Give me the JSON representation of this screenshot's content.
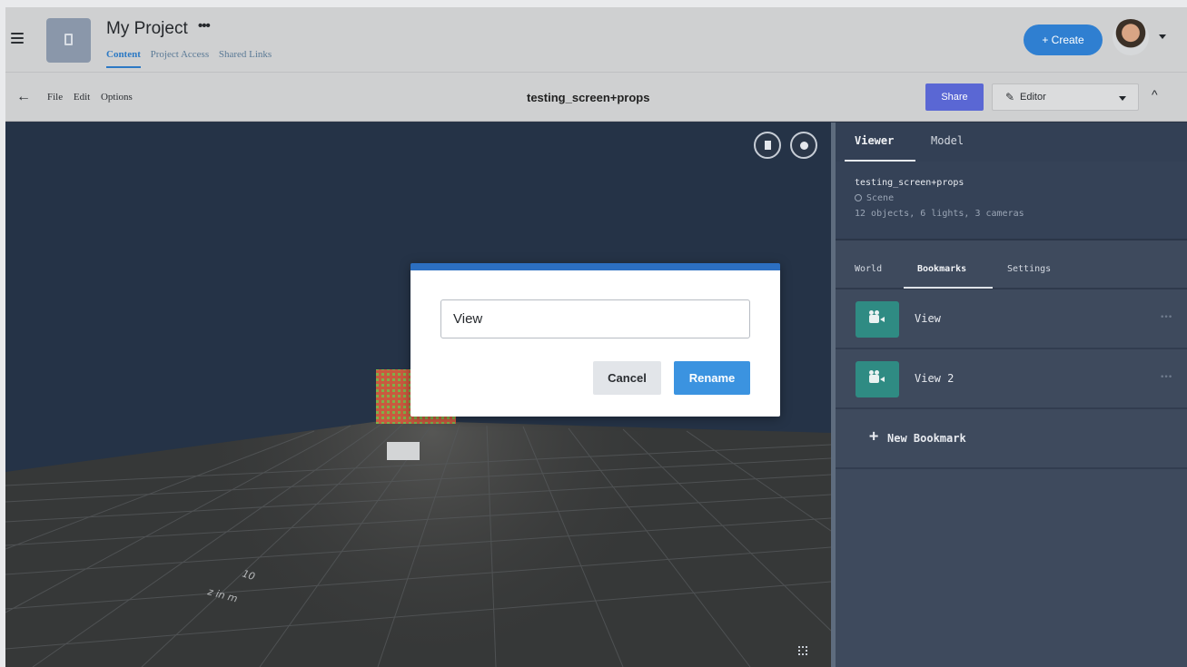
{
  "project": {
    "title": "My Project",
    "more_label": "•••",
    "tabs": [
      {
        "label": "Content",
        "active": true
      },
      {
        "label": "Project Access",
        "active": false
      },
      {
        "label": "Shared Links",
        "active": false
      }
    ]
  },
  "header": {
    "create_label": "+ Create"
  },
  "toolbar": {
    "back_icon": "←",
    "menu": [
      "File",
      "Edit",
      "Options"
    ],
    "document_title": "testing_screen+props",
    "share_label": "Share",
    "editor_label": "Editor",
    "collapse_icon": "^"
  },
  "viewport": {
    "axis_label": "z in m",
    "axis_ticks": [
      "10"
    ]
  },
  "dialog": {
    "input_value": "View",
    "cancel_label": "Cancel",
    "rename_label": "Rename"
  },
  "panel": {
    "tabs": [
      "Viewer",
      "Model"
    ],
    "scene_name": "testing_screen+props",
    "scene_type": "Scene",
    "scene_stats": "12 objects, 6 lights, 3 cameras",
    "sub_tabs": [
      "World",
      "Bookmarks",
      "Settings"
    ],
    "bookmarks": [
      {
        "label": "View"
      },
      {
        "label": "View 2"
      }
    ],
    "new_bookmark_label": "New Bookmark"
  },
  "colors": {
    "accent": "#2f7fd1",
    "share": "#5a67d4",
    "bookmark_icon": "#2f8b83",
    "viewport_bg": "#253347",
    "panel_bg": "#3e4a5d"
  }
}
